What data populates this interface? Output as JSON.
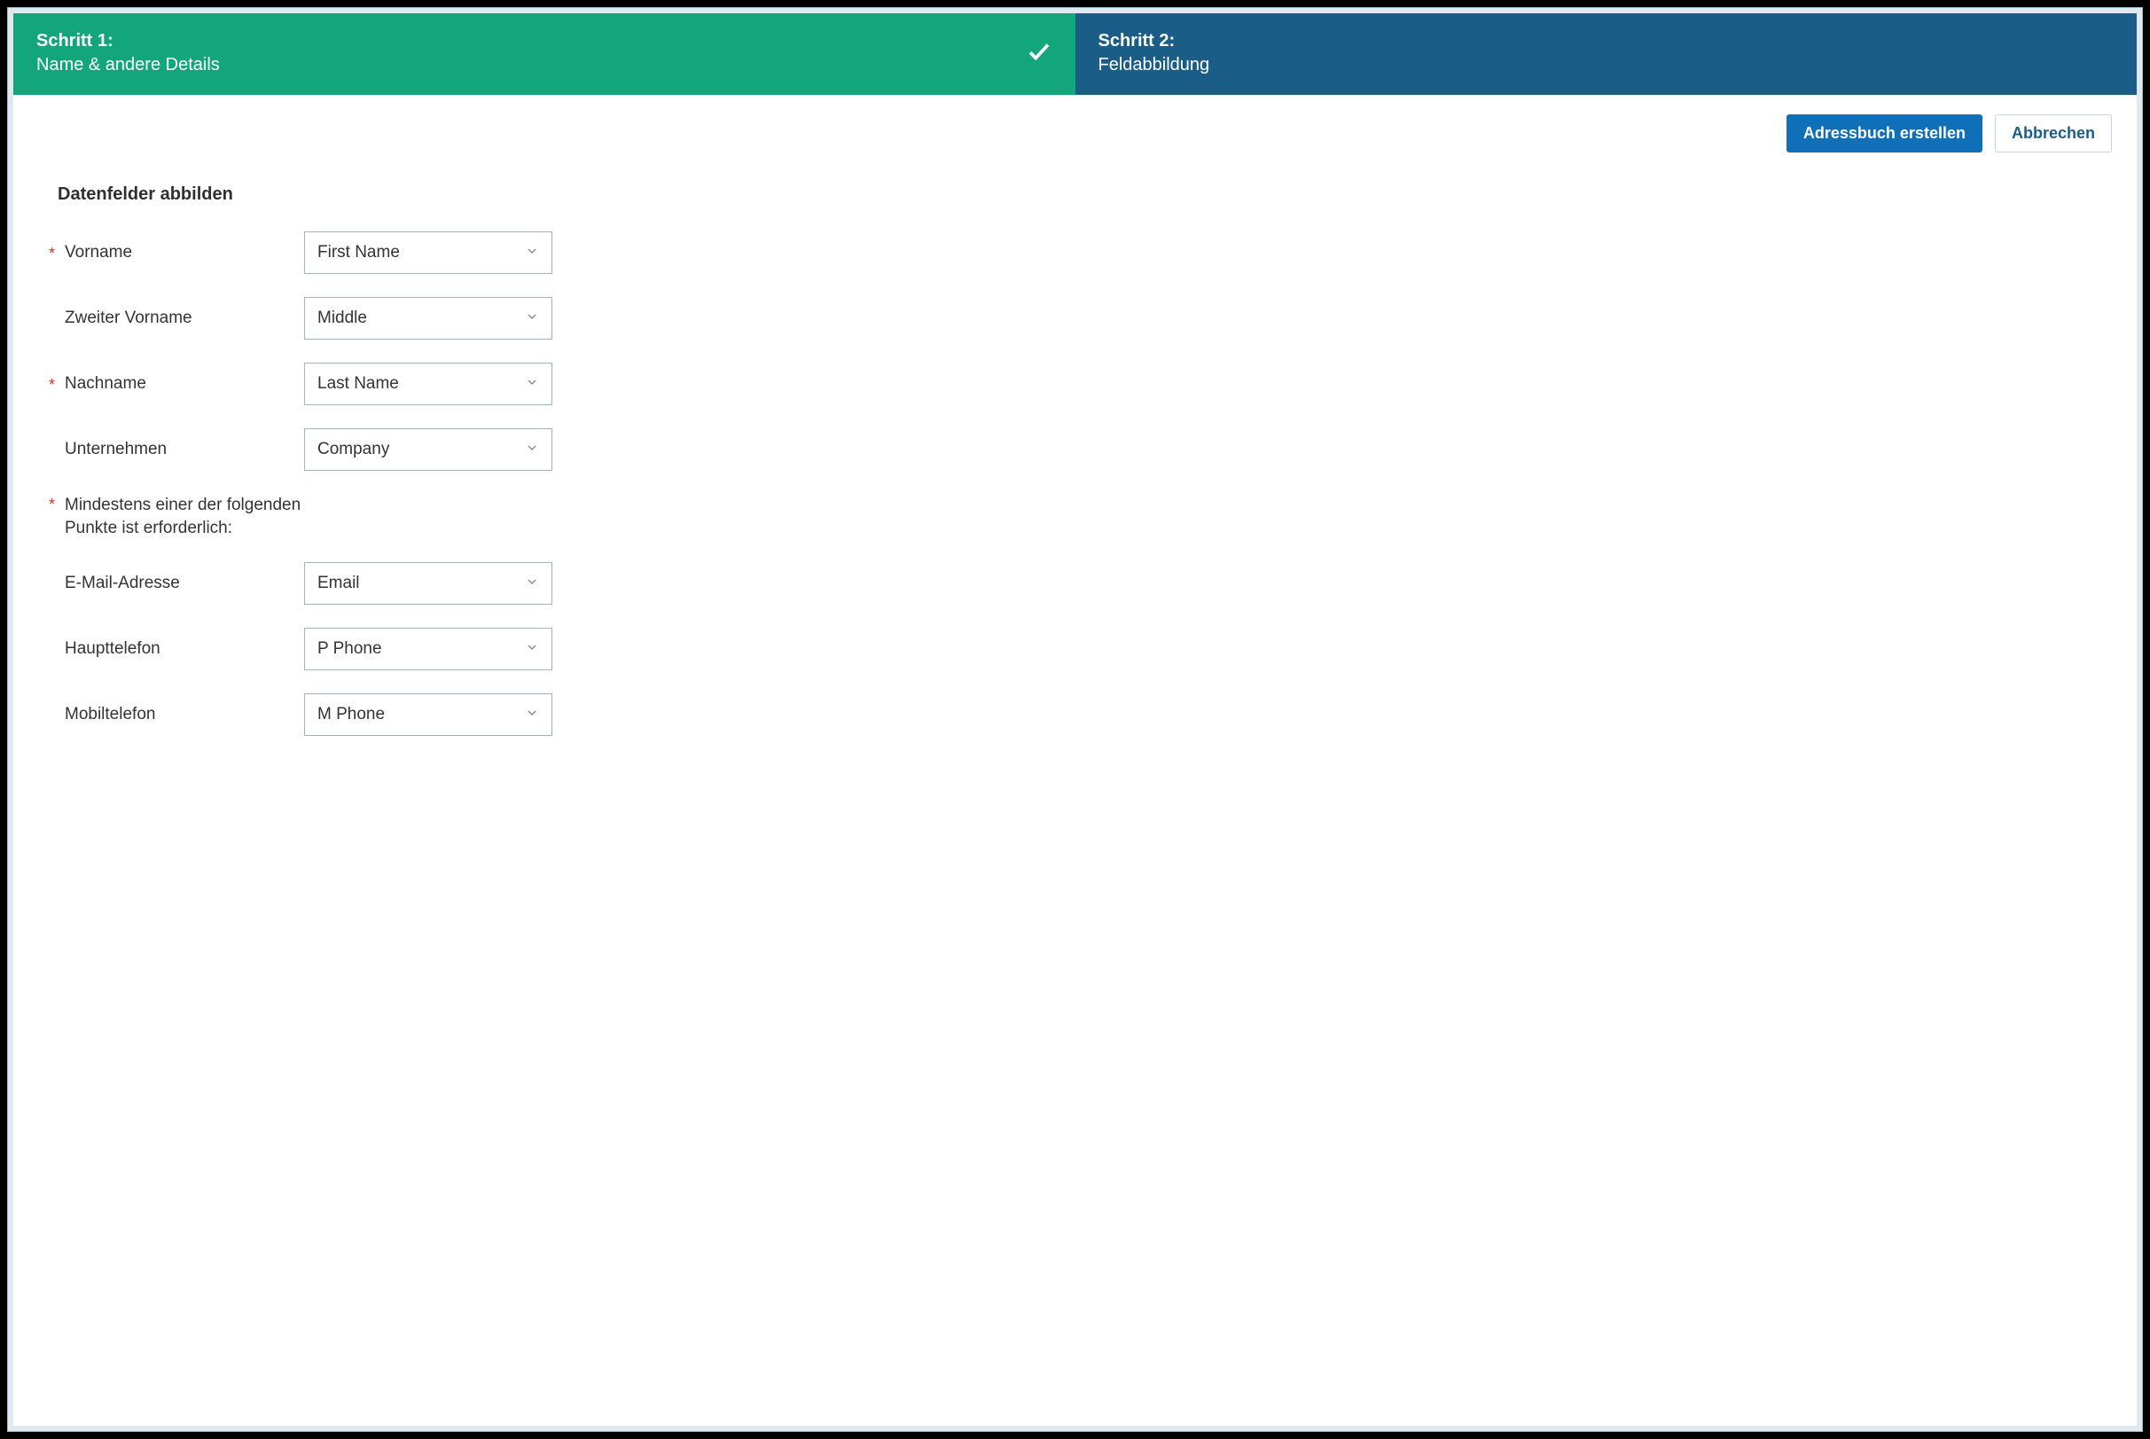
{
  "stepper": {
    "step1": {
      "num": "Schritt 1:",
      "name": "Name & andere Details"
    },
    "step2": {
      "num": "Schritt 2:",
      "name": "Feldabbildung"
    }
  },
  "actions": {
    "create": "Adressbuch erstellen",
    "cancel": "Abbrechen"
  },
  "section": {
    "title": "Datenfelder abbilden"
  },
  "fields": {
    "firstname": {
      "label": "Vorname",
      "value": "First Name",
      "required": true
    },
    "middlename": {
      "label": "Zweiter Vorname",
      "value": "Middle",
      "required": false
    },
    "lastname": {
      "label": "Nachname",
      "value": "Last Name",
      "required": true
    },
    "company": {
      "label": "Unternehmen",
      "value": "Company",
      "required": false
    },
    "note": {
      "label": "Mindestens einer der folgenden Punkte ist erforderlich:",
      "required": true
    },
    "email": {
      "label": "E-Mail-Adresse",
      "value": "Email",
      "required": false
    },
    "mainphone": {
      "label": "Haupttelefon",
      "value": "P Phone",
      "required": false
    },
    "mobile": {
      "label": "Mobiltelefon",
      "value": "M Phone",
      "required": false
    }
  }
}
